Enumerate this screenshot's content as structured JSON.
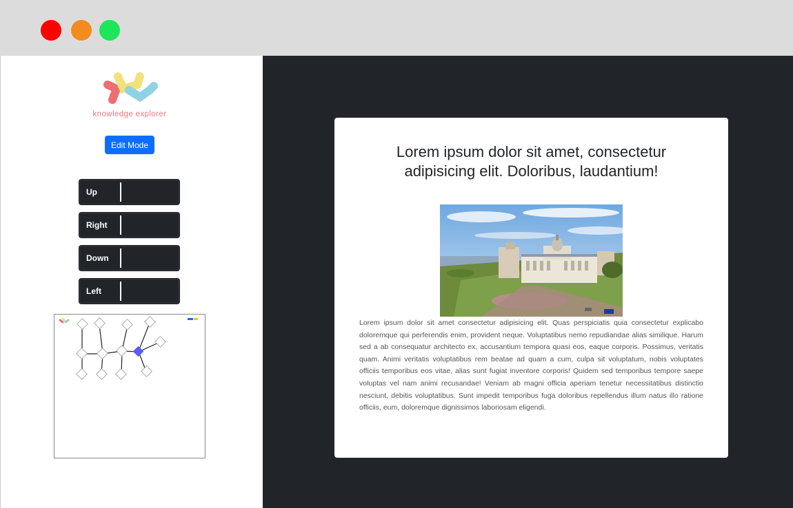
{
  "window": {
    "controls": [
      "close",
      "minimize",
      "maximize"
    ],
    "colors": {
      "close": "#ff0000",
      "minimize": "#f28c1e",
      "maximize": "#1ee65a"
    }
  },
  "sidebar": {
    "logo_text": "knowledge explorer",
    "logo_icon": "knowledge-explorer-logo",
    "edit_button": "Edit Mode",
    "directions": [
      {
        "label": "Up"
      },
      {
        "label": "Right"
      },
      {
        "label": "Down"
      },
      {
        "label": "Left"
      }
    ],
    "minimap_icon": "graph-minimap"
  },
  "main": {
    "title": "Lorem ipsum dolor sit amet, consectetur adipisicing elit. Doloribus, laudantium!",
    "image_icon": "city-palace-photo",
    "body": "Lorem ipsum dolor sit amet consectetur adipisicing elit. Quas perspiciatis quia consectetur explicabo doloremque qui perferendis enim, provident neque. Voluptatibus nemo repudiandae alias similique. Harum sed a ab consequatur architecto ex, accusantium tempora quasi eos, eaque corporis. Possimus, veritatis quam. Animi veritatis voluptatibus rem beatae ad quam a cum, culpa sit voluptatum, nobis voluptates officiis temporibus eos vitae, alias sunt fugiat inventore corporis! Quidem sed temporibus tempore saepe voluptas vel nam animi recusandae! Veniam ab magni officia aperiam tenetur necessitatibus distinctio nesciunt, debitis voluptatibus. Sunt impedit temporibus fuga doloribus repellendus illum natus illo ratione officiis, eum, doloremque dignissimos laboriosam eligendi."
  },
  "colors": {
    "accent": "#0d6efd",
    "dark": "#212529",
    "active_node": "#5a5af5",
    "logo_red": "#ec6f73",
    "logo_yellow": "#f1e27c",
    "logo_cyan": "#8fd3e3"
  }
}
